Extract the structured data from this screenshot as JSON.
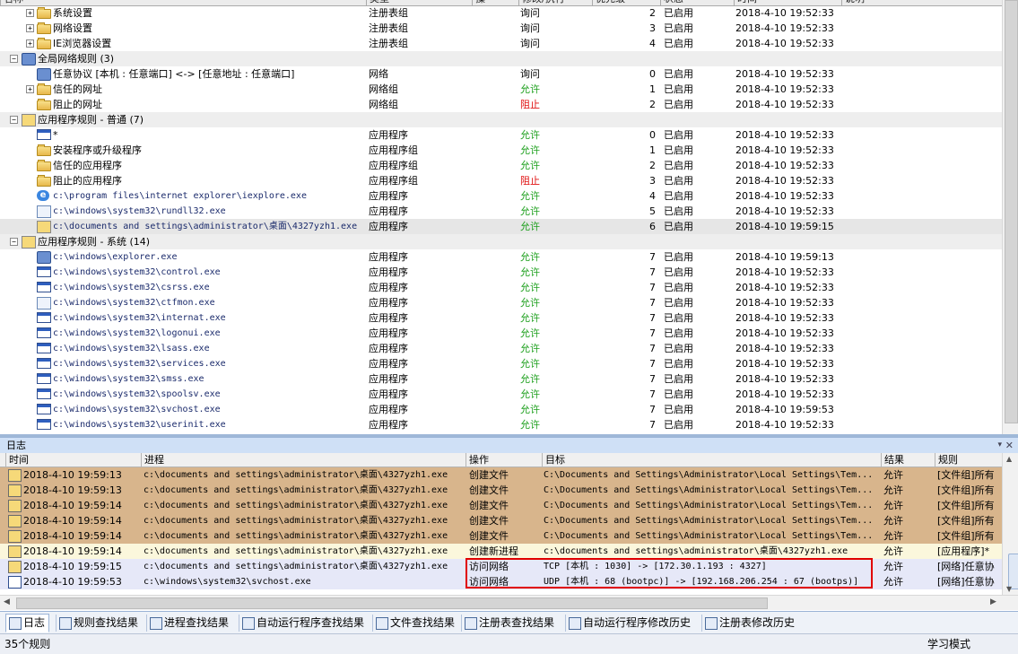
{
  "tree_header": [
    "名称",
    "类型",
    "操",
    "修改/执行",
    "优先级",
    "状态",
    "时间",
    "说明"
  ],
  "tree_rows": [
    {
      "level": 1,
      "expander": "+",
      "icon": "folder-icon",
      "name": "系统设置",
      "type": "注册表组",
      "action": "询问",
      "action_color": "normal",
      "priority": "2",
      "status": "已启用",
      "time": "2018-4-10  19:52:33"
    },
    {
      "level": 1,
      "expander": "+",
      "icon": "folder-icon",
      "name": "网络设置",
      "type": "注册表组",
      "action": "询问",
      "action_color": "normal",
      "priority": "3",
      "status": "已启用",
      "time": "2018-4-10  19:52:33"
    },
    {
      "level": 1,
      "expander": "+",
      "icon": "folder-icon",
      "name": "IE浏览器设置",
      "type": "注册表组",
      "action": "询问",
      "action_color": "normal",
      "priority": "4",
      "status": "已启用",
      "time": "2018-4-10  19:52:33"
    },
    {
      "level": 0,
      "expander": "-",
      "icon": "network-icon",
      "name": "全局网络规则 (3)",
      "group": true
    },
    {
      "level": 1,
      "expander": "",
      "icon": "network-icon",
      "name": "任意协议 [本机 : 任意端口] <-> [任意地址 : 任意端口]",
      "type": "网络",
      "action": "询问",
      "action_color": "normal",
      "priority": "0",
      "status": "已启用",
      "time": "2018-4-10  19:52:33"
    },
    {
      "level": 1,
      "expander": "+",
      "icon": "folder-icon",
      "name": "信任的网址",
      "type": "网络组",
      "action": "允许",
      "action_color": "allow",
      "priority": "1",
      "status": "已启用",
      "time": "2018-4-10  19:52:33"
    },
    {
      "level": 1,
      "expander": "",
      "icon": "folder-icon",
      "name": "阻止的网址",
      "type": "网络组",
      "action": "阻止",
      "action_color": "deny",
      "priority": "2",
      "status": "已启用",
      "time": "2018-4-10  19:52:33"
    },
    {
      "level": 0,
      "expander": "-",
      "icon": "app-rule-icon",
      "name": "应用程序规则 - 普通 (7)",
      "group": true
    },
    {
      "level": 1,
      "expander": "",
      "icon": "window-icon",
      "name": "*",
      "type": "应用程序",
      "action": "允许",
      "action_color": "allow",
      "priority": "0",
      "status": "已启用",
      "time": "2018-4-10  19:52:33"
    },
    {
      "level": 1,
      "expander": "",
      "icon": "folder-icon",
      "name": "安装程序或升级程序",
      "type": "应用程序组",
      "action": "允许",
      "action_color": "allow",
      "priority": "1",
      "status": "已启用",
      "time": "2018-4-10  19:52:33"
    },
    {
      "level": 1,
      "expander": "",
      "icon": "folder-icon",
      "name": "信任的应用程序",
      "type": "应用程序组",
      "action": "允许",
      "action_color": "allow",
      "priority": "2",
      "status": "已启用",
      "time": "2018-4-10  19:52:33"
    },
    {
      "level": 1,
      "expander": "",
      "icon": "folder-icon",
      "name": "阻止的应用程序",
      "type": "应用程序组",
      "action": "阻止",
      "action_color": "deny",
      "priority": "3",
      "status": "已启用",
      "time": "2018-4-10  19:52:33"
    },
    {
      "level": 1,
      "expander": "",
      "icon": "ie-icon",
      "name": "c:\\program files\\internet explorer\\iexplore.exe",
      "type": "应用程序",
      "action": "允许",
      "action_color": "allow",
      "priority": "4",
      "status": "已启用",
      "time": "2018-4-10  19:52:33",
      "path": true
    },
    {
      "level": 1,
      "expander": "",
      "icon": "document-icon",
      "name": "c:\\windows\\system32\\rundll32.exe",
      "type": "应用程序",
      "action": "允许",
      "action_color": "allow",
      "priority": "5",
      "status": "已启用",
      "time": "2018-4-10  19:52:33",
      "path": true
    },
    {
      "level": 1,
      "expander": "",
      "icon": "app-file-icon",
      "name": "c:\\documents and settings\\administrator\\桌面\\4327yzh1.exe",
      "type": "应用程序",
      "action": "允许",
      "action_color": "allow",
      "priority": "6",
      "status": "已启用",
      "time": "2018-4-10  19:59:15",
      "path": true,
      "selected": true
    },
    {
      "level": 0,
      "expander": "-",
      "icon": "app-rule-icon",
      "name": "应用程序规则 - 系统 (14)",
      "group": true
    },
    {
      "level": 1,
      "expander": "",
      "icon": "explorer-icon",
      "name": "c:\\windows\\explorer.exe",
      "type": "应用程序",
      "action": "允许",
      "action_color": "allow",
      "priority": "7",
      "status": "已启用",
      "time": "2018-4-10  19:59:13",
      "path": true
    },
    {
      "level": 1,
      "expander": "",
      "icon": "window-icon",
      "name": "c:\\windows\\system32\\control.exe",
      "type": "应用程序",
      "action": "允许",
      "action_color": "allow",
      "priority": "7",
      "status": "已启用",
      "time": "2018-4-10  19:52:33",
      "path": true
    },
    {
      "level": 1,
      "expander": "",
      "icon": "window-icon",
      "name": "c:\\windows\\system32\\csrss.exe",
      "type": "应用程序",
      "action": "允许",
      "action_color": "allow",
      "priority": "7",
      "status": "已启用",
      "time": "2018-4-10  19:52:33",
      "path": true
    },
    {
      "level": 1,
      "expander": "",
      "icon": "edit-icon",
      "name": "c:\\windows\\system32\\ctfmon.exe",
      "type": "应用程序",
      "action": "允许",
      "action_color": "allow",
      "priority": "7",
      "status": "已启用",
      "time": "2018-4-10  19:52:33",
      "path": true
    },
    {
      "level": 1,
      "expander": "",
      "icon": "window-icon",
      "name": "c:\\windows\\system32\\internat.exe",
      "type": "应用程序",
      "action": "允许",
      "action_color": "allow",
      "priority": "7",
      "status": "已启用",
      "time": "2018-4-10  19:52:33",
      "path": true
    },
    {
      "level": 1,
      "expander": "",
      "icon": "window-icon",
      "name": "c:\\windows\\system32\\logonui.exe",
      "type": "应用程序",
      "action": "允许",
      "action_color": "allow",
      "priority": "7",
      "status": "已启用",
      "time": "2018-4-10  19:52:33",
      "path": true
    },
    {
      "level": 1,
      "expander": "",
      "icon": "window-icon",
      "name": "c:\\windows\\system32\\lsass.exe",
      "type": "应用程序",
      "action": "允许",
      "action_color": "allow",
      "priority": "7",
      "status": "已启用",
      "time": "2018-4-10  19:52:33",
      "path": true
    },
    {
      "level": 1,
      "expander": "",
      "icon": "window-icon",
      "name": "c:\\windows\\system32\\services.exe",
      "type": "应用程序",
      "action": "允许",
      "action_color": "allow",
      "priority": "7",
      "status": "已启用",
      "time": "2018-4-10  19:52:33",
      "path": true
    },
    {
      "level": 1,
      "expander": "",
      "icon": "window-icon",
      "name": "c:\\windows\\system32\\smss.exe",
      "type": "应用程序",
      "action": "允许",
      "action_color": "allow",
      "priority": "7",
      "status": "已启用",
      "time": "2018-4-10  19:52:33",
      "path": true
    },
    {
      "level": 1,
      "expander": "",
      "icon": "window-icon",
      "name": "c:\\windows\\system32\\spoolsv.exe",
      "type": "应用程序",
      "action": "允许",
      "action_color": "allow",
      "priority": "7",
      "status": "已启用",
      "time": "2018-4-10  19:52:33",
      "path": true
    },
    {
      "level": 1,
      "expander": "",
      "icon": "window-icon",
      "name": "c:\\windows\\system32\\svchost.exe",
      "type": "应用程序",
      "action": "允许",
      "action_color": "allow",
      "priority": "7",
      "status": "已启用",
      "time": "2018-4-10  19:59:53",
      "path": true
    },
    {
      "level": 1,
      "expander": "",
      "icon": "window-icon",
      "name": "c:\\windows\\system32\\userinit.exe",
      "type": "应用程序",
      "action": "允许",
      "action_color": "allow",
      "priority": "7",
      "status": "已启用",
      "time": "2018-4-10  19:52:33",
      "path": true
    }
  ],
  "log_panel": {
    "title": "日志",
    "pin_icon": "pin-icon",
    "close_icon": "close-icon"
  },
  "log_header": [
    "时间",
    "进程",
    "操作",
    "目标",
    "结果",
    "规则"
  ],
  "log_rows": [
    {
      "style": "brown",
      "icon": "app-file-icon",
      "time": "2018-4-10 19:59:13",
      "process": "c:\\documents and settings\\administrator\\桌面\\4327yzh1.exe",
      "operation": "创建文件",
      "target": "C:\\Documents and Settings\\Administrator\\Local Settings\\Tem...",
      "result": "允许",
      "rule": "[文件组]所有"
    },
    {
      "style": "brown",
      "icon": "app-file-icon",
      "time": "2018-4-10 19:59:13",
      "process": "c:\\documents and settings\\administrator\\桌面\\4327yzh1.exe",
      "operation": "创建文件",
      "target": "C:\\Documents and Settings\\Administrator\\Local Settings\\Tem...",
      "result": "允许",
      "rule": "[文件组]所有"
    },
    {
      "style": "brown",
      "icon": "app-file-icon",
      "time": "2018-4-10 19:59:14",
      "process": "c:\\documents and settings\\administrator\\桌面\\4327yzh1.exe",
      "operation": "创建文件",
      "target": "C:\\Documents and Settings\\Administrator\\Local Settings\\Tem...",
      "result": "允许",
      "rule": "[文件组]所有"
    },
    {
      "style": "brown",
      "icon": "app-file-icon",
      "time": "2018-4-10 19:59:14",
      "process": "c:\\documents and settings\\administrator\\桌面\\4327yzh1.exe",
      "operation": "创建文件",
      "target": "C:\\Documents and Settings\\Administrator\\Local Settings\\Tem...",
      "result": "允许",
      "rule": "[文件组]所有"
    },
    {
      "style": "brown",
      "icon": "app-file-icon",
      "time": "2018-4-10 19:59:14",
      "process": "c:\\documents and settings\\administrator\\桌面\\4327yzh1.exe",
      "operation": "创建文件",
      "target": "C:\\Documents and Settings\\Administrator\\Local Settings\\Tem...",
      "result": "允许",
      "rule": "[文件组]所有"
    },
    {
      "style": "yellow",
      "icon": "app-file-icon",
      "time": "2018-4-10 19:59:14",
      "process": "c:\\documents and settings\\administrator\\桌面\\4327yzh1.exe",
      "operation": "创建新进程",
      "target": "c:\\documents and settings\\administrator\\桌面\\4327yzh1.exe",
      "result": "允许",
      "rule": "[应用程序]*"
    },
    {
      "style": "blue",
      "icon": "app-file-icon",
      "time": "2018-4-10 19:59:15",
      "process": "c:\\documents and settings\\administrator\\桌面\\4327yzh1.exe",
      "operation": "访问网络",
      "target": "TCP [本机 : 1030] -> [172.30.1.193 : 4327]",
      "result": "允许",
      "rule": "[网络]任意协"
    },
    {
      "style": "blue",
      "icon": "window-icon",
      "time": "2018-4-10 19:59:53",
      "process": "c:\\windows\\system32\\svchost.exe",
      "operation": "访问网络",
      "target": "UDP [本机 : 68 (bootpc)] -> [192.168.206.254 : 67 (bootps)]",
      "result": "允许",
      "rule": "[网络]任意协"
    }
  ],
  "tabs": [
    {
      "label": "日志",
      "icon": "log-icon",
      "active": true
    },
    {
      "label": "规则查找结果",
      "icon": "rule-search-icon"
    },
    {
      "label": "进程查找结果",
      "icon": "process-search-icon"
    },
    {
      "label": "自动运行程序查找结果",
      "icon": "autorun-search-icon"
    },
    {
      "label": "文件查找结果",
      "icon": "file-search-icon"
    },
    {
      "label": "注册表查找结果",
      "icon": "registry-search-icon"
    },
    {
      "label": "自动运行程序修改历史",
      "icon": "autorun-history-icon"
    },
    {
      "label": "注册表修改历史",
      "icon": "registry-history-icon"
    }
  ],
  "status": {
    "left": "35个规则",
    "right": "学习模式"
  },
  "colors": {
    "allow": "#1ea01e",
    "deny": "#e01010",
    "highlight_box": "#e00000",
    "log_brown": "#d8b58c",
    "log_yellow": "#fbf7dc",
    "log_blue": "#e6e8f8"
  }
}
